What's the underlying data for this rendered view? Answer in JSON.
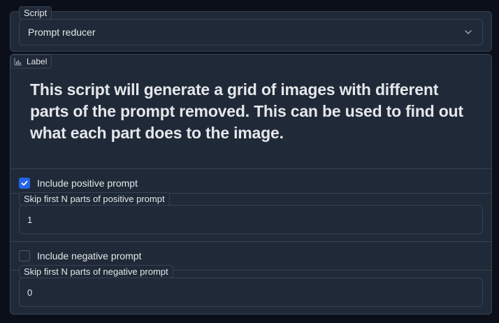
{
  "script": {
    "label": "Script",
    "selected": "Prompt reducer"
  },
  "description": {
    "badge": "Label",
    "text": "This script will generate a grid of images with different parts of the prompt removed. This can be used to find out what each part does to the image."
  },
  "positive": {
    "checkbox_label": "Include positive prompt",
    "checked": true,
    "skip_label": "Skip first N parts of positive prompt",
    "skip_value": "1"
  },
  "negative": {
    "checkbox_label": "Include negative prompt",
    "checked": false,
    "skip_label": "Skip first N parts of negative prompt",
    "skip_value": "0"
  },
  "colors": {
    "accent": "#2563eb",
    "panel": "#1f2937",
    "border": "#374151",
    "background": "#0b0f19"
  }
}
